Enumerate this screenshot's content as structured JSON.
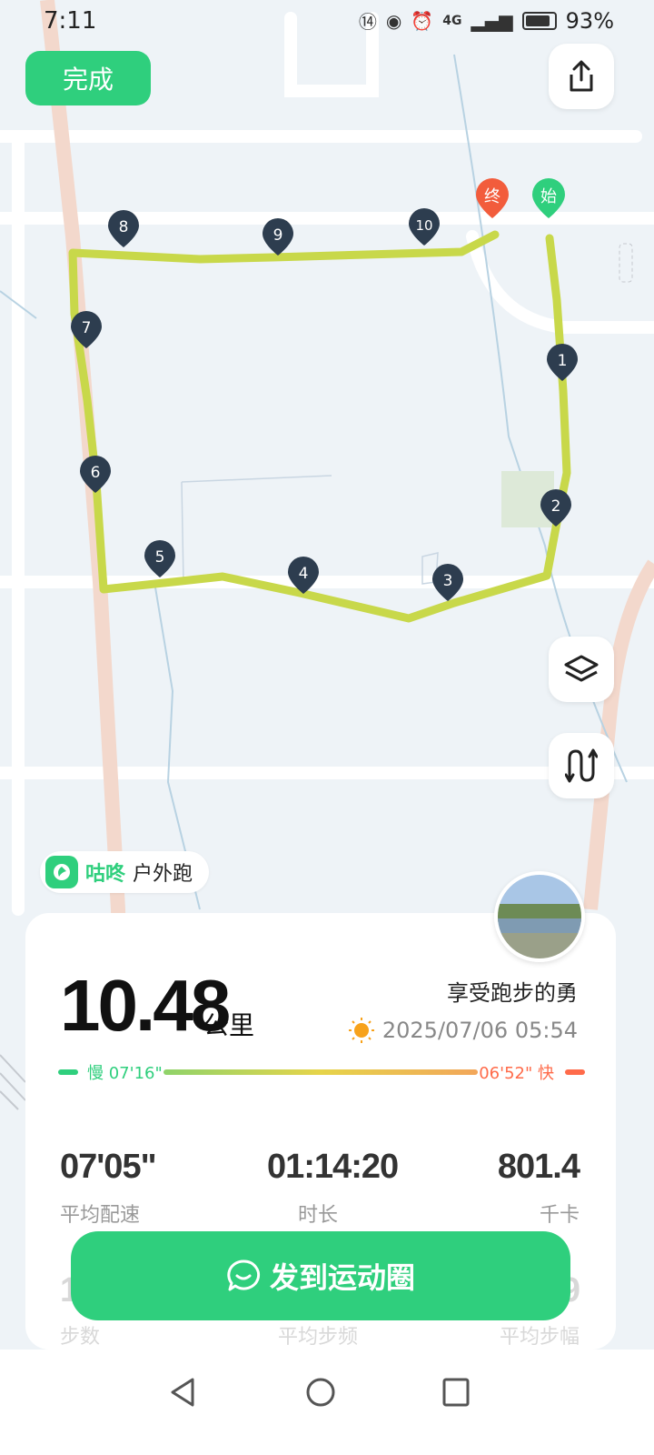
{
  "status": {
    "time": "7:11",
    "network": "4G",
    "battery": "93%"
  },
  "toolbar": {
    "done_label": "完成",
    "share_icon": "share-icon",
    "layers_icon": "layers-icon",
    "route_icon": "route-icon"
  },
  "map": {
    "route_color": "#c8d84a",
    "markers": [
      "1",
      "2",
      "3",
      "4",
      "5",
      "6",
      "7",
      "8",
      "9",
      "10"
    ],
    "start_label": "始",
    "end_label": "终"
  },
  "brand": {
    "name": "咕咚",
    "activity": "户外跑"
  },
  "summary": {
    "distance": "10.48",
    "distance_unit": "公里",
    "user_name": "享受跑步的勇",
    "datetime": "2025/07/06 05:54",
    "pace_slow": "慢 07'16\"",
    "pace_fast": "06'52\" 快"
  },
  "stats": [
    {
      "value": "07'05\"",
      "label": "平均配速"
    },
    {
      "value": "01:14:20",
      "label": "时长"
    },
    {
      "value": "801.4",
      "label": "千卡"
    }
  ],
  "stats_hidden": [
    {
      "value": "1",
      "label": "步数"
    },
    {
      "label": "平均步频"
    },
    {
      "value": "9",
      "label": "平均步幅"
    }
  ],
  "cta": {
    "label": "发到运动圈"
  },
  "colors": {
    "accent": "#2fcf7d",
    "fast": "#ff6b4a"
  }
}
